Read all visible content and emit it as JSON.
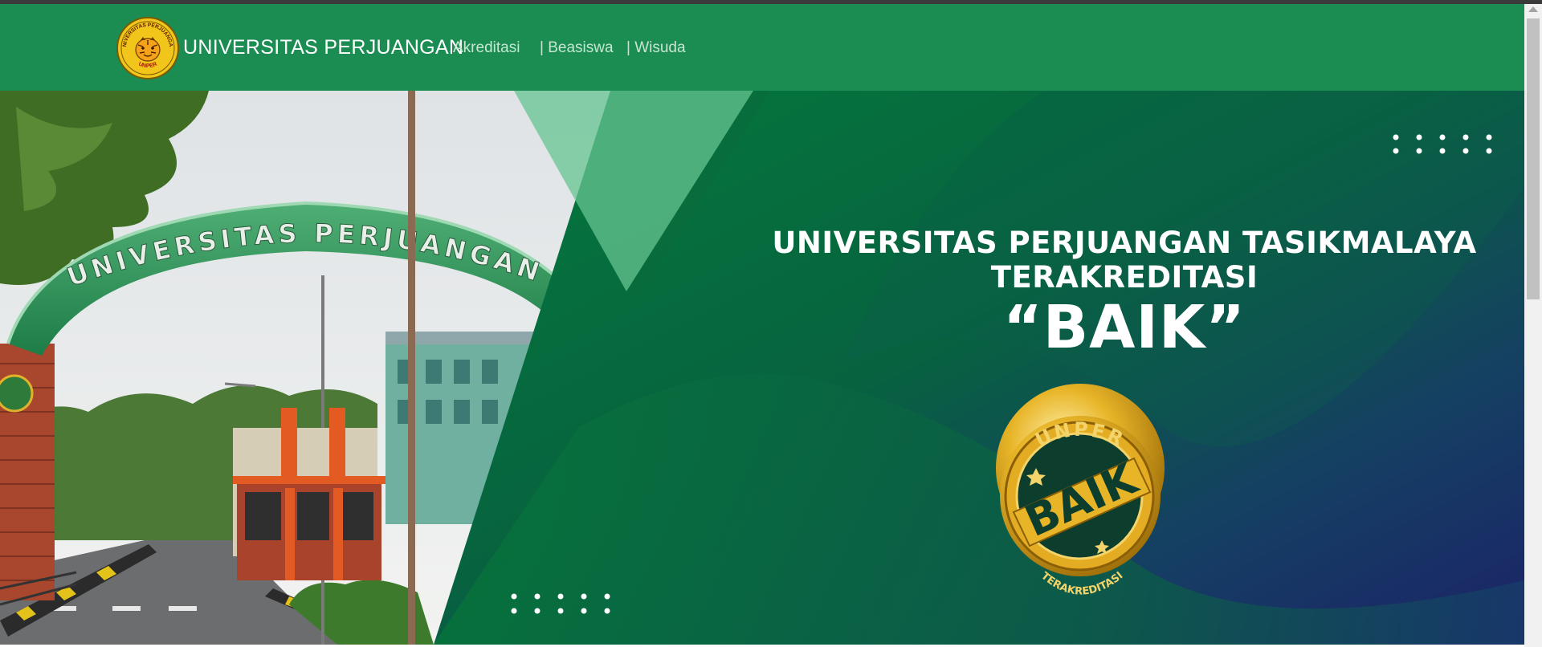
{
  "colors": {
    "navbar": "#1b8c52",
    "hero_green": "#057a3e",
    "hero_navy": "#1a2464",
    "gold": "#e8b528"
  },
  "navbar": {
    "brand": "UNIVERSITAS PERJUANGAN",
    "logo_text_top": "UNIVERSITAS PERJUANGAN",
    "logo_text_bottom": "UNPER",
    "links": [
      {
        "label": "Akreditasi"
      },
      {
        "label": "| Beasiswa"
      },
      {
        "label": "| Wisuda"
      }
    ]
  },
  "hero": {
    "gate_sign": "UNIVERSITAS PERJUANGAN",
    "line1": "UNIVERSITAS PERJUANGAN TASIKMALAYA",
    "line2": "TERAKREDITASI",
    "line3": "“BAIK”",
    "badge": {
      "top": "UNPER",
      "center": "BAIK",
      "bottom": "TERAKREDITASI"
    }
  },
  "icons": {
    "logo": "unper-logo-icon",
    "badge": "accreditation-badge-icon",
    "dots": "dot-pattern-icon",
    "scroll": "scroll-up-arrow-icon"
  }
}
